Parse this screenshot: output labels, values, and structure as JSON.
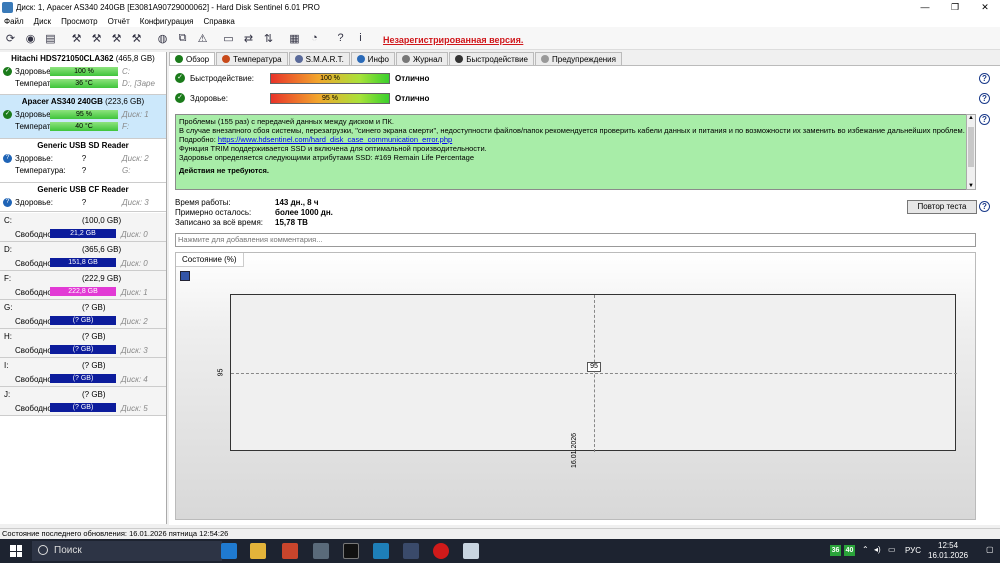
{
  "window": {
    "title": "Диск: 1, Apacer AS340 240GB [E3081A90729000062]  -  Hard Disk Sentinel 6.01 PRO",
    "min": "—",
    "max": "❐",
    "close": "✕"
  },
  "menu": [
    "Файл",
    "Диск",
    "Просмотр",
    "Отчёт",
    "Конфигурация",
    "Справка"
  ],
  "toolbar": {
    "unregistered": "Незарегистрированная версия."
  },
  "disks": [
    {
      "name": "Hitachi HDS721050CLA362",
      "size": "(465,8 GB)",
      "health_label": "Здоровье:",
      "health": "100 %",
      "health_frac": 1.0,
      "health_extra": "C:",
      "temp_label": "Температура:",
      "temp": "36 °C",
      "temp_extra": "D:, [Заре"
    },
    {
      "name": "Apacer AS340 240GB",
      "size": "(223,6 GB)",
      "health_label": "Здоровье:",
      "health": "95 %",
      "health_frac": 0.95,
      "health_extra": "Диск: 1",
      "temp_label": "Температура:",
      "temp": "40 °C",
      "temp_extra": "F:"
    },
    {
      "name": "Generic USB SD Reader",
      "size": "",
      "health_label": "Здоровье:",
      "health": "?",
      "health_extra": "Диск: 2",
      "temp_label": "Температура:",
      "temp": "?",
      "temp_extra": "G:"
    },
    {
      "name": "Generic USB CF Reader",
      "size": "",
      "health_label": "Здоровье:",
      "health": "?",
      "health_extra": "Диск: 3"
    }
  ],
  "volumes": [
    {
      "letter": "C:",
      "size": "(100,0 GB)",
      "free_label": "Свободно",
      "free": "21,2 GB",
      "disk": "Диск: 0"
    },
    {
      "letter": "D:",
      "size": "(365,6 GB)",
      "free_label": "Свободно",
      "free": "151,8 GB",
      "disk": "Диск: 0"
    },
    {
      "letter": "F:",
      "size": "(222,9 GB)",
      "free_label": "Свободно",
      "free": "222,8 GB",
      "disk": "Диск: 1"
    },
    {
      "letter": "G:",
      "size": "(? GB)",
      "free_label": "Свободно",
      "free": "(? GB)",
      "disk": "Диск: 2"
    },
    {
      "letter": "H:",
      "size": "(? GB)",
      "free_label": "Свободно",
      "free": "(? GB)",
      "disk": "Диск: 3"
    },
    {
      "letter": "I:",
      "size": "(? GB)",
      "free_label": "Свободно",
      "free": "(? GB)",
      "disk": "Диск: 4"
    },
    {
      "letter": "J:",
      "size": "(? GB)",
      "free_label": "Свободно",
      "free": "(? GB)",
      "disk": "Диск: 5"
    }
  ],
  "tabs": [
    "Обзор",
    "Температура",
    "S.M.A.R.T.",
    "Инфо",
    "Журнал",
    "Быстродействие",
    "Предупреждения"
  ],
  "overview": {
    "perf_label": "Быстродействие:",
    "perf": "100 %",
    "perf_frac": 1.0,
    "perf_word": "Отлично",
    "health_label": "Здоровье:",
    "health": "95 %",
    "health_frac": 0.95,
    "health_word": "Отлично",
    "msg1": "Проблемы (155 раз) с передачей данных между диском и ПК.",
    "msg2": "В случае внезапного сбоя системы, перезагрузки, \"синего экрана смерти\", недоступности файлов/папок рекомендуется проверить кабели данных и питания и по возможности их заменить во избежание дальнейших проблем.",
    "msg3_prefix": "Подробно: ",
    "msg3_link": "https://www.hdsentinel.com/hard_disk_case_communication_error.php",
    "msg4": "Функция TRIM поддерживается SSD и включена для оптимальной производительности.",
    "msg5": "Здоровье определяется следующими атрибутами SSD: #169 Remain Life Percentage",
    "msg6": "Действия не требуются.",
    "uptime_label": "Время работы:",
    "uptime": "143 дн., 8 ч",
    "remain_label": "Примерно осталось:",
    "remain": "более 1000 дн.",
    "written_label": "Записано за всё время:",
    "written": "15,78 TB",
    "retest": "Повтор теста",
    "comment_placeholder": "Нажмите для добавления комментария..."
  },
  "chart_tab": "Состояние (%)",
  "chart_data": {
    "type": "line",
    "x": [
      "16.01.2026"
    ],
    "series": [
      {
        "values": [
          95
        ]
      }
    ],
    "ytick": "95"
  },
  "statusbar": "Состояние последнего обновления: 16.01.2026 пятница 12:54:26",
  "taskbar": {
    "search": "Поиск",
    "badge1": "36",
    "badge2": "40",
    "lang": "РУС",
    "time": "12:54",
    "date": "16.01.2026"
  }
}
